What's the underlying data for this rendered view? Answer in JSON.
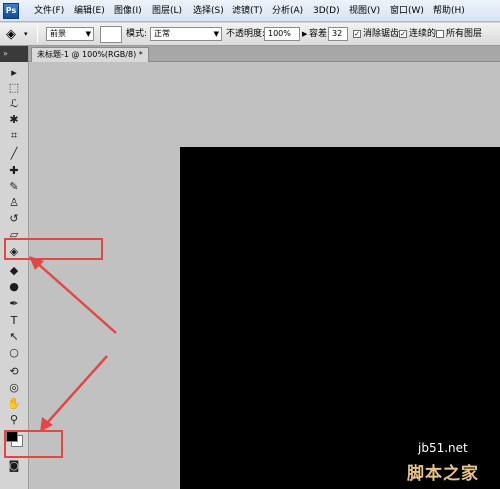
{
  "menubar": {
    "logo": "Ps",
    "items": [
      "文件(F)",
      "编辑(E)",
      "图像(I)",
      "图层(L)",
      "选择(S)",
      "滤镜(T)",
      "分析(A)",
      "3D(D)",
      "视图(V)",
      "窗口(W)",
      "帮助(H)"
    ]
  },
  "options": {
    "fill_source": "前景",
    "mode_label": "模式:",
    "mode_value": "正常",
    "opacity_label": "不透明度:",
    "opacity_value": "100%",
    "tolerance_label": "容差:",
    "tolerance_value": "32",
    "antialias_label": "消除锯齿",
    "antialias_checked": true,
    "contiguous_label": "连续的",
    "contiguous_checked": true,
    "all_layers_label": "所有图层",
    "all_layers_checked": false
  },
  "document": {
    "tab_title": "未标题-1 @ 100%(RGB/8) *"
  },
  "toolbox": {
    "grip": "»",
    "tools": [
      {
        "name": "move-tool-icon",
        "glyph": "▸"
      },
      {
        "name": "marquee-tool-icon",
        "glyph": "⬚"
      },
      {
        "name": "lasso-tool-icon",
        "glyph": "ℒ"
      },
      {
        "name": "magic-wand-tool-icon",
        "glyph": "✱"
      },
      {
        "name": "crop-tool-icon",
        "glyph": "⌗"
      },
      {
        "name": "eyedropper-tool-icon",
        "glyph": "╱"
      },
      {
        "name": "healing-brush-tool-icon",
        "glyph": "✚"
      },
      {
        "name": "brush-tool-icon",
        "glyph": "✎"
      },
      {
        "name": "clone-stamp-tool-icon",
        "glyph": "♙"
      },
      {
        "name": "history-brush-tool-icon",
        "glyph": "↺"
      },
      {
        "name": "eraser-tool-icon",
        "glyph": "▱"
      },
      {
        "name": "paint-bucket-tool-icon",
        "glyph": "◈"
      },
      {
        "name": "blur-tool-icon",
        "glyph": "◆"
      },
      {
        "name": "dodge-tool-icon",
        "glyph": "●"
      },
      {
        "name": "pen-tool-icon",
        "glyph": "✒"
      },
      {
        "name": "type-tool-icon",
        "glyph": "T"
      },
      {
        "name": "path-selection-tool-icon",
        "glyph": "↖"
      },
      {
        "name": "shape-tool-icon",
        "glyph": "○"
      },
      {
        "name": "3d-rotate-tool-icon",
        "glyph": "⟲"
      },
      {
        "name": "3d-orbit-tool-icon",
        "glyph": "◎"
      },
      {
        "name": "hand-tool-icon",
        "glyph": "✋"
      },
      {
        "name": "zoom-tool-icon",
        "glyph": "⚲"
      }
    ],
    "quick_mask_glyph": "◙"
  },
  "colors": {
    "foreground": "#000000",
    "background": "#ffffff",
    "canvas": "#000000",
    "annotation": "#e04848"
  },
  "watermark": {
    "site": "jb51.net",
    "brand": "脚本之家"
  }
}
